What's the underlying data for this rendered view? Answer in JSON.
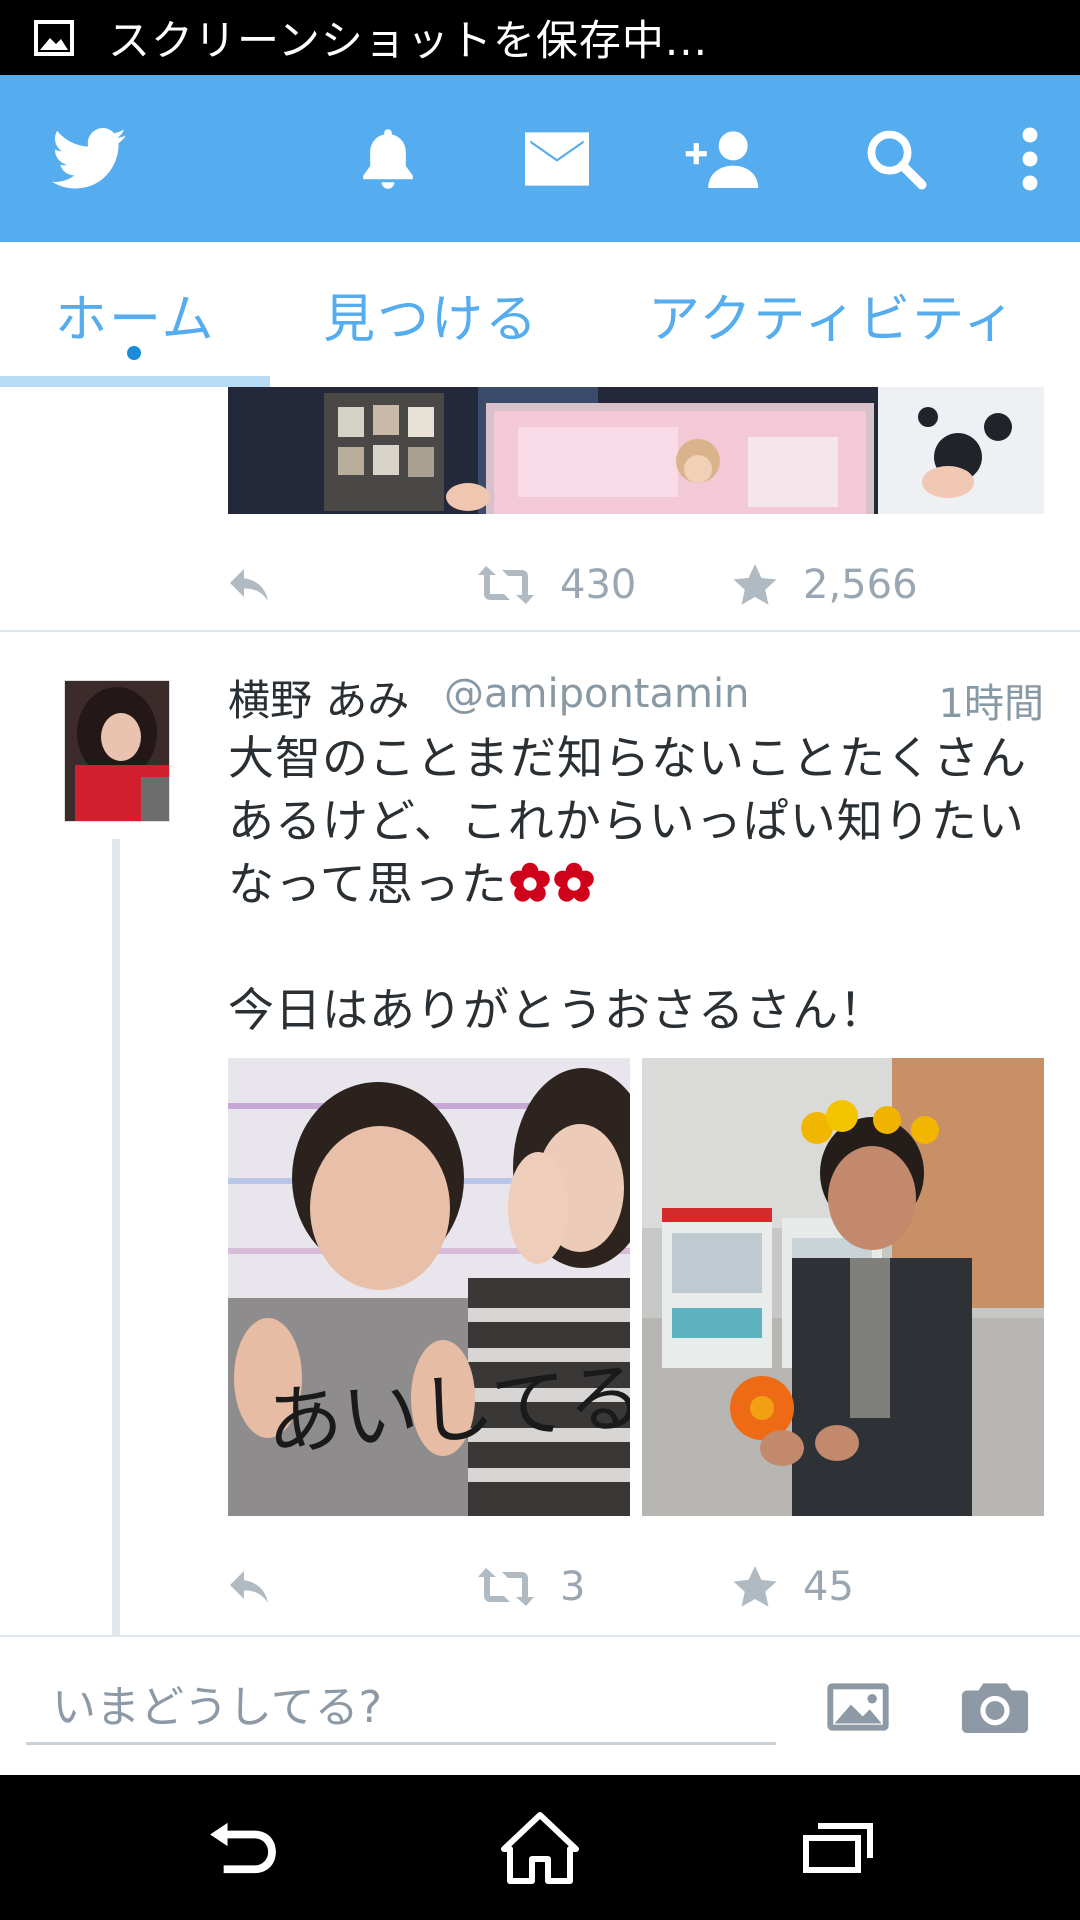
{
  "status_bar": {
    "icon": "image-icon",
    "text": "スクリーンショットを保存中..."
  },
  "app_bar": {
    "icons": [
      "twitter-bird-icon",
      "bell-icon",
      "envelope-icon",
      "add-person-icon",
      "search-icon",
      "overflow-menu-icon"
    ],
    "background_color": "#55acee"
  },
  "tabs": [
    {
      "label": "ホーム",
      "selected": true
    },
    {
      "label": "見つける",
      "selected": false
    },
    {
      "label": "アクティビティ",
      "selected": false
    }
  ],
  "feed": {
    "tweets": [
      {
        "partial": true,
        "media": [
          "photo"
        ],
        "actions": {
          "reply_icon": "reply-icon",
          "retweet_icon": "retweet-icon",
          "retweets": "430",
          "favorite_icon": "star-icon",
          "favorites": "2,566"
        }
      },
      {
        "author_name": "横野 あみ",
        "author_handle": "@amipontamin",
        "time": "1時間",
        "text_line1": "大智のことまだ知らないことたくさん",
        "text_line2": "あるけど、これからいっぱい知りたい",
        "text_line3": "なって思った",
        "text_line5": "今日はありがとうおさるさん！",
        "emoji": [
          "red-flower-icon",
          "red-flower-icon"
        ],
        "media": [
          "photo",
          "photo"
        ],
        "photo_handwriting": "あいしてる—。",
        "actions": {
          "reply_icon": "reply-icon",
          "retweet_icon": "retweet-icon",
          "retweets": "3",
          "favorite_icon": "star-icon",
          "favorites": "45"
        }
      }
    ]
  },
  "compose": {
    "placeholder": "いまどうしてる?",
    "icons": [
      "image-icon",
      "camera-icon"
    ]
  },
  "nav_bar": {
    "icons": [
      "back-icon",
      "home-icon",
      "recent-apps-icon"
    ]
  }
}
